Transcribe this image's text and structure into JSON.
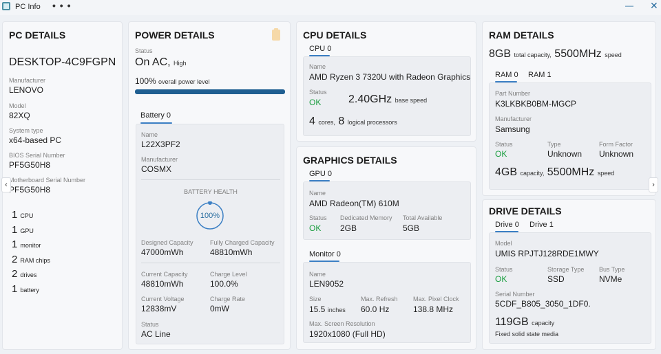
{
  "window": {
    "title": "PC Info",
    "more": "• • •",
    "minimize": "—",
    "close": "✕"
  },
  "pc": {
    "heading": "PC DETAILS",
    "name": "DESKTOP-4C9FGPN",
    "manufacturer_label": "Manufacturer",
    "manufacturer": "LENOVO",
    "model_label": "Model",
    "model": "82XQ",
    "system_type_label": "System type",
    "system_type": "x64-based PC",
    "bios_label": "BIOS Serial Number",
    "bios": "PF5G50H8",
    "mobo_label": "Motherboard Serial Number",
    "mobo": "PF5G50H8",
    "counts": [
      {
        "n": "1",
        "unit": "CPU"
      },
      {
        "n": "1",
        "unit": "GPU"
      },
      {
        "n": "1",
        "unit": "monitor"
      },
      {
        "n": "2",
        "unit": "RAM chips"
      },
      {
        "n": "2",
        "unit": "drives"
      },
      {
        "n": "1",
        "unit": "battery"
      }
    ]
  },
  "power": {
    "heading": "POWER DETAILS",
    "status_label": "Status",
    "status": "On AC,",
    "status_sub": "High",
    "level": "100%",
    "level_sub": "overall power level",
    "level_fraction": 1.0,
    "battery_tab": "Battery 0",
    "name_label": "Name",
    "name": "L22X3PF2",
    "manufacturer_label": "Manufacturer",
    "manufacturer": "COSMX",
    "health_label": "BATTERY HEALTH",
    "health": "100%",
    "health_fraction": 1.0,
    "designed_label": "Designed Capacity",
    "designed": "47000mWh",
    "full_label": "Fully Charged Capacity",
    "full": "48810mWh",
    "current_cap_label": "Current Capacity",
    "current_cap": "48810mWh",
    "charge_level_label": "Charge Level",
    "charge_level": "100.0%",
    "voltage_label": "Current Voltage",
    "voltage": "12838mV",
    "rate_label": "Charge Rate",
    "rate": "0mW",
    "bstatus_label": "Status",
    "bstatus": "AC Line"
  },
  "cpu": {
    "heading": "CPU DETAILS",
    "tab": "CPU 0",
    "name_label": "Name",
    "name": "AMD Ryzen 3 7320U with Radeon Graphics",
    "status_label": "Status",
    "status": "OK",
    "speed": "2.40GHz",
    "speed_sub": "base speed",
    "cores": "4",
    "cores_sub": "cores,",
    "logical": "8",
    "logical_sub": "logical processors"
  },
  "graphics": {
    "heading": "GRAPHICS DETAILS",
    "tab": "GPU 0",
    "name_label": "Name",
    "name": "AMD Radeon(TM) 610M",
    "status_label": "Status",
    "status": "OK",
    "dedicated_label": "Dedicated Memory",
    "dedicated": "2GB",
    "total_label": "Total Available",
    "total": "5GB",
    "monitor_tab": "Monitor 0",
    "mname_label": "Name",
    "mname": "LEN9052",
    "size_label": "Size",
    "size": "15.5",
    "size_sub": "inches",
    "refresh_label": "Max. Refresh",
    "refresh": "60.0 Hz",
    "pixel_label": "Max. Pixel Clock",
    "pixel": "138.8 MHz",
    "res_label": "Max. Screen Resolution",
    "res": "1920x1080 (Full HD)"
  },
  "ram": {
    "heading": "RAM DETAILS",
    "total": "8GB",
    "total_sub": "total capacity,",
    "speed": "5500MHz",
    "speed_sub": "speed",
    "tabs": [
      "RAM 0",
      "RAM 1"
    ],
    "part_label": "Part Number",
    "part": "K3LKBKB0BM-MGCP",
    "manufacturer_label": "Manufacturer",
    "manufacturer": "Samsung",
    "status_label": "Status",
    "status": "OK",
    "type_label": "Type",
    "type": "Unknown",
    "form_label": "Form Factor",
    "form": "Unknown",
    "cap": "4GB",
    "cap_sub": "capacity,",
    "cap_speed": "5500MHz",
    "cap_speed_sub": "speed"
  },
  "drive": {
    "heading": "DRIVE DETAILS",
    "tabs": [
      "Drive 0",
      "Drive 1"
    ],
    "model_label": "Model",
    "model": "UMIS RPJTJ128RDE1MWY",
    "status_label": "Status",
    "status": "OK",
    "storage_label": "Storage Type",
    "storage": "SSD",
    "bus_label": "Bus Type",
    "bus": "NVMe",
    "serial_label": "Serial Number",
    "serial": "5CDF_B805_3050_1DF0.",
    "capacity": "119GB",
    "capacity_sub": "capacity",
    "media": "Fixed solid state media"
  },
  "nav": {
    "left": "‹",
    "right": "›"
  }
}
